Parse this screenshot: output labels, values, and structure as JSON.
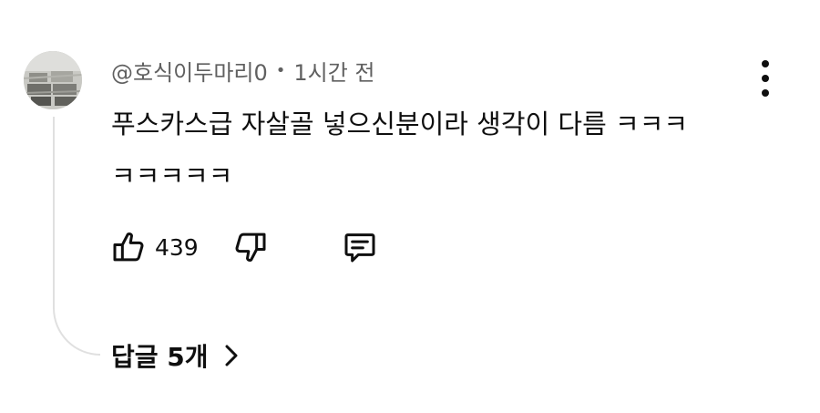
{
  "comment": {
    "author": "@호식이두마리0",
    "separator": "•",
    "time": "1시간 전",
    "text": "푸스카스급 자살골 넣으신분이라 생각이 다름 ㅋㅋㅋ ㅋㅋㅋㅋㅋ",
    "like_count": "439",
    "replies_label": "답글 5개"
  },
  "icons": {
    "avatar": "avatar-image",
    "more": "more-vertical-icon",
    "like": "thumbs-up-icon",
    "dislike": "thumbs-down-icon",
    "reply": "comment-reply-icon",
    "expand": "chevron-right-icon"
  },
  "colors": {
    "text_primary": "#0f0f0f",
    "text_secondary": "#606060",
    "thread_line": "#e0e0e0"
  }
}
